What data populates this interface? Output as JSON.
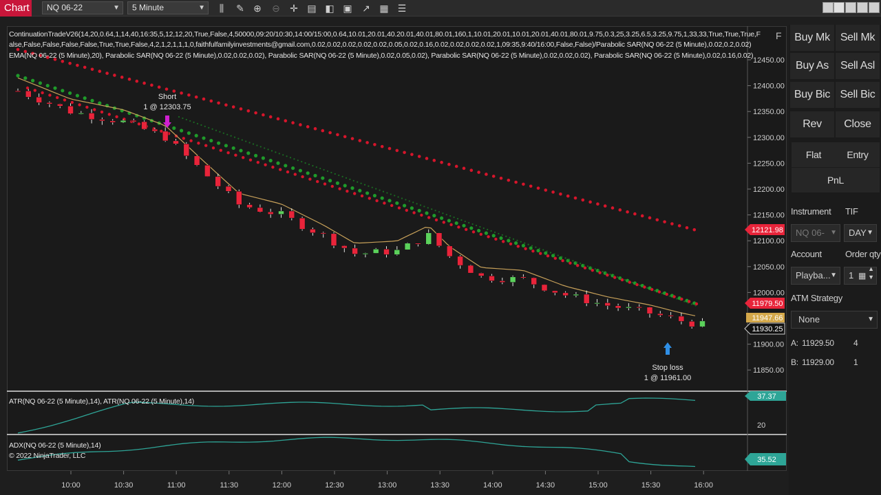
{
  "toolbar": {
    "title": "Chart",
    "instrument": "NQ 06-22",
    "interval": "5 Minute",
    "icons": [
      "bar-type-icon",
      "pencil-icon",
      "zoom-in-icon",
      "zoom-out-icon",
      "crosshair-icon",
      "data-box-icon",
      "indicators-icon",
      "strategies-icon",
      "drawing-tools-icon",
      "properties-icon",
      "list-icon"
    ]
  },
  "indicators": {
    "line1": "ContinuationTradeV26(14,20,0.64,1,14,40,16:35,5,12,12,20,True,False,4,50000,09:20/10:30,14:00/15:00,0.64,10.01,20.01,40.20.01,40.01,80.01,160,1,10.01,20.01,10.01,20.01,40.01,80.01,9.75,0.3,25,3.25,6.5,3.25,9.75,1,33,33,True,True,True,F",
    "line2": "alse,False,False,False,False,True,True,False,4,2,1,2,1,1,1,0,faithfulfamilyinvestments@gmail.com,0.02,0.02,0.02,0.02,0.02,0.05,0.02,0.16,0.02,0.02,0.02,0.02,1,09:35,9:40/16:00,False,False)/Parabolic SAR(NQ 06-22 (5 Minute),0.02,0.2,0.02)",
    "line3": "EMA(NQ 06-22 (5 Minute),20), Parabolic SAR(NQ 06-22 (5 Minute),0.02,0.02,0.02), Parabolic SAR(NQ 06-22 (5 Minute),0.02,0.05,0.02), Parabolic SAR(NQ 06-22 (5 Minute),0.02,0.02,0.02), Parabolic SAR(NQ 06-22 (5 Minute),0.02,0.16,0.02)",
    "atr_label": "ATR(NQ 06-22 (5 Minute),14), ATR(NQ 06-22 (5 Minute),14)",
    "adx_label": "ADX(NQ 06-22 (5 Minute),14)",
    "copyright": "© 2022 NinjaTrader, LLC",
    "f_label": "F"
  },
  "markers": {
    "short_title": "Short",
    "short_detail": "1 @ 12303.75",
    "stop_title": "Stop loss",
    "stop_detail": "1 @ 11961.00"
  },
  "price_axis": {
    "ticks": [
      "12450.00",
      "12400.00",
      "12350.00",
      "12300.00",
      "12250.00",
      "12200.00",
      "12150.00",
      "12100.00",
      "12050.00",
      "12000.00",
      "11950.00",
      "11900.00",
      "11850.00"
    ],
    "flag_sar": "12121.98",
    "flag_stop": "11979.50",
    "flag_ema": "11947.66",
    "flag_last": "11930.25",
    "atr_flag": "37.37",
    "atr_tick": "20",
    "adx_flag": "35.52"
  },
  "time_axis": [
    "10:00",
    "10:30",
    "11:00",
    "11:30",
    "12:00",
    "12:30",
    "13:00",
    "13:30",
    "14:00",
    "14:30",
    "15:00",
    "15:30",
    "16:00"
  ],
  "panel": {
    "buttons": [
      "Buy Mk",
      "Sell Mk",
      "Buy As",
      "Sell Asl",
      "Buy Bic",
      "Sell Bic",
      "Rev",
      "Close"
    ],
    "flat": "Flat",
    "entry": "Entry",
    "pnl": "PnL",
    "instrument_label": "Instrument",
    "tif_label": "TIF",
    "instrument_value": "NQ 06-",
    "tif_value": "DAY",
    "account_label": "Account",
    "orderqty_label": "Order qty",
    "account_value": "Playba...",
    "qty_value": "1",
    "atm_label": "ATM Strategy",
    "atm_value": "None",
    "ask_label": "A:",
    "ask_price": "11929.50",
    "ask_size": "4",
    "bid_label": "B:",
    "bid_price": "11929.00",
    "bid_size": "1"
  },
  "colors": {
    "up": "#5bd15b",
    "down": "#e8243a",
    "ema": "#c9a25a",
    "sar_red": "#d6152b",
    "sar_green": "#1f9a2a",
    "indicator_line": "#2ea597"
  }
}
